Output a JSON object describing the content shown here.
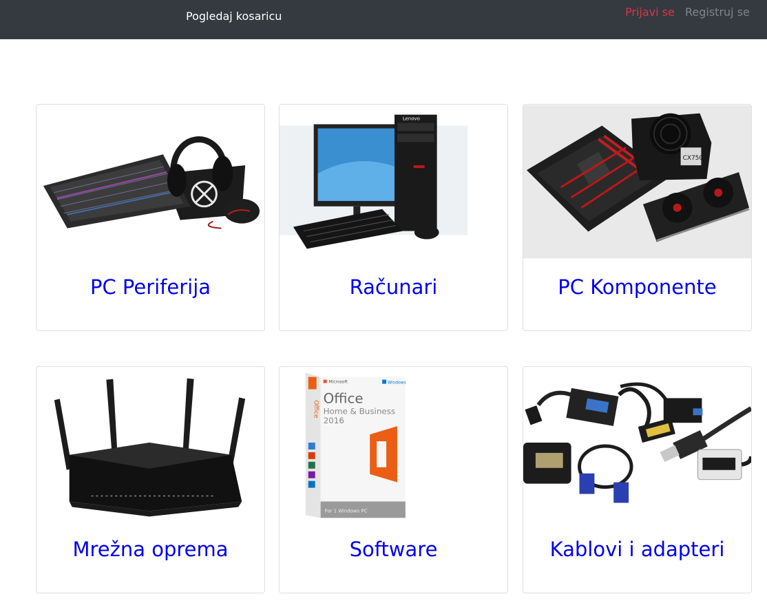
{
  "navbar": {
    "cart_label": "Pogledaj kosaricu",
    "login_label": "Prijavi se",
    "register_label": "Registruj se"
  },
  "categories": [
    {
      "title": "PC Periferija",
      "icon": "keyboard-headset-mouse-image"
    },
    {
      "title": "Računari",
      "icon": "desktop-computer-image"
    },
    {
      "title": "PC Komponente",
      "icon": "motherboard-psu-gpu-image"
    },
    {
      "title": "Mrežna oprema",
      "icon": "router-image"
    },
    {
      "title": "Software",
      "icon": "office-box-image"
    },
    {
      "title": "Kablovi i adapteri",
      "icon": "cables-adapters-image"
    }
  ],
  "software_box": {
    "brand": "Microsoft",
    "windows": "Windows",
    "product": "Office",
    "edition": "Home & Business",
    "year": "2016",
    "side": "Office",
    "footer": "For 1 Windows PC"
  },
  "components_box": {
    "psu_label": "CX750"
  },
  "colors": {
    "navbar_bg": "#343a40",
    "login": "#dc3545",
    "register": "#7f858a",
    "link": "#0000ee",
    "office_orange": "#eb5e14"
  }
}
